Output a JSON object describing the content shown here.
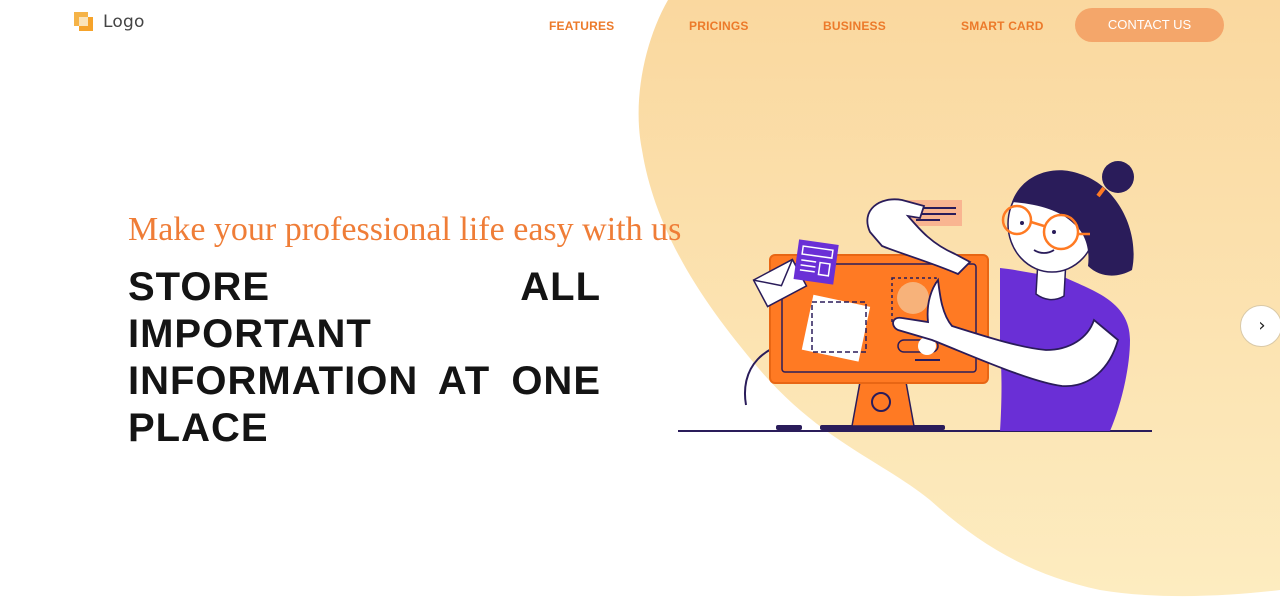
{
  "header": {
    "logo_text": "Logo",
    "nav": {
      "features": "FEATURES",
      "pricings": "PRICINGS",
      "business": "BUSINESS",
      "smart_card": "SMART CARD"
    },
    "contact_label": "CONTACT US"
  },
  "hero": {
    "tagline": "Make your professional life easy with us",
    "headline": "STORE ALL IMPORTANT INFORMATION AT ONE PLACE"
  },
  "carousel": {
    "next_icon": "›"
  },
  "colors": {
    "accent": "#ec7a2a",
    "button_bg": "#f4a66a",
    "blob": "#fbe0ad",
    "illustration_purple": "#6a2fd6",
    "illustration_orange": "#ff7a23"
  },
  "icons": {
    "logo_mark": "logo-mark-icon",
    "next": "chevron-right-icon"
  }
}
